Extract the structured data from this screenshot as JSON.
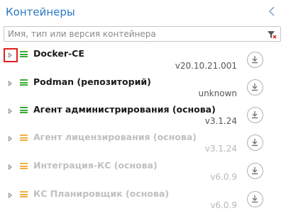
{
  "panel": {
    "title": "Контейнеры",
    "collapse_icon": "chevron-left-icon"
  },
  "search": {
    "placeholder": "Имя, тип или версия контейнера",
    "value": "",
    "clear_icon": "filter-clear-icon"
  },
  "colors": {
    "accent": "#2b79c2",
    "status_green": "#3aaa35",
    "status_orange": "#f0b040",
    "highlight_red": "#e02020"
  },
  "items": [
    {
      "name": "Docker-CE",
      "version": "v20.10.21.001",
      "state": "active",
      "status_color": "green"
    },
    {
      "name": "Podman (репозиторий)",
      "version": "unknown",
      "state": "active",
      "status_color": "green"
    },
    {
      "name": "Агент администрирования (основа)",
      "version": "v3.1.24",
      "state": "active",
      "status_color": "green"
    },
    {
      "name": "Агент лицензирования (основа)",
      "version": "v3.1.24",
      "state": "inactive",
      "status_color": "orange"
    },
    {
      "name": "Интеграция-КС (основа)",
      "version": "v6.0.9",
      "state": "inactive",
      "status_color": "orange"
    },
    {
      "name": "КС Планировщик (основа)",
      "version": "v6.0.9",
      "state": "inactive",
      "status_color": "orange"
    }
  ]
}
